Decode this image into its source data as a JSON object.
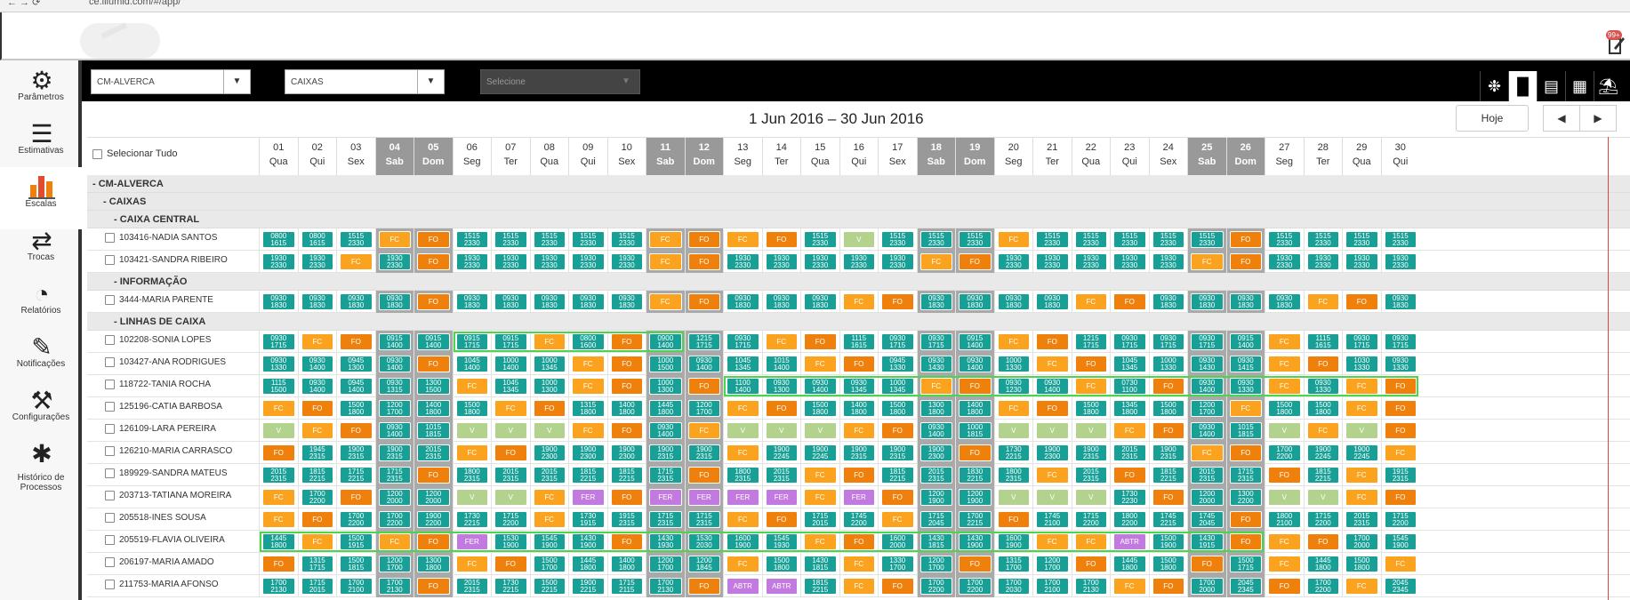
{
  "browser": {
    "url": "ce.illumid.com/#/app/"
  },
  "notifications": {
    "badge": "99+"
  },
  "sidebar": {
    "items": [
      {
        "label": "Parâmetros",
        "icon": "gear-icon"
      },
      {
        "label": "Estimativas",
        "icon": "chart-line-icon"
      },
      {
        "label": "Escalas",
        "icon": "bar-chart-icon"
      },
      {
        "label": "Trocas",
        "icon": "swap-icon"
      },
      {
        "label": "Relatórios",
        "icon": "pie-chart-icon"
      },
      {
        "label": "Notificações",
        "icon": "notification-edit-icon"
      },
      {
        "label": "Configurações",
        "icon": "settings-tools-icon"
      },
      {
        "label": "Histórico de Processos",
        "icon": "history-calendar-icon"
      }
    ]
  },
  "filters": {
    "store": "CM-ALVERCA",
    "department": "CAIXAS",
    "third_placeholder": "Selecione"
  },
  "views": [
    "settings-icon",
    "bar-chart-icon",
    "column-chart-icon",
    "calendar-icon",
    "vacation-icon"
  ],
  "calendar": {
    "title": "1 Jun 2016 – 30 Jun 2016",
    "today_label": "Hoje",
    "prev": "◀",
    "next": "▶"
  },
  "grid": {
    "select_all_label": "Selecionar Tudo"
  },
  "days": [
    {
      "n": "01",
      "w": "Qua"
    },
    {
      "n": "02",
      "w": "Qui"
    },
    {
      "n": "03",
      "w": "Sex"
    },
    {
      "n": "04",
      "w": "Sab",
      "we": true
    },
    {
      "n": "05",
      "w": "Dom",
      "we": true
    },
    {
      "n": "06",
      "w": "Seg"
    },
    {
      "n": "07",
      "w": "Ter"
    },
    {
      "n": "08",
      "w": "Qua"
    },
    {
      "n": "09",
      "w": "Qui"
    },
    {
      "n": "10",
      "w": "Sex"
    },
    {
      "n": "11",
      "w": "Sab",
      "we": true
    },
    {
      "n": "12",
      "w": "Dom",
      "we": true
    },
    {
      "n": "13",
      "w": "Seg"
    },
    {
      "n": "14",
      "w": "Ter"
    },
    {
      "n": "15",
      "w": "Qua"
    },
    {
      "n": "16",
      "w": "Qui"
    },
    {
      "n": "17",
      "w": "Sex"
    },
    {
      "n": "18",
      "w": "Sab",
      "we": true
    },
    {
      "n": "19",
      "w": "Dom",
      "we": true
    },
    {
      "n": "20",
      "w": "Seg"
    },
    {
      "n": "21",
      "w": "Ter"
    },
    {
      "n": "22",
      "w": "Qua"
    },
    {
      "n": "23",
      "w": "Qui"
    },
    {
      "n": "24",
      "w": "Sex"
    },
    {
      "n": "25",
      "w": "Sab",
      "we": true
    },
    {
      "n": "26",
      "w": "Dom",
      "we": true
    },
    {
      "n": "27",
      "w": "Seg"
    },
    {
      "n": "28",
      "w": "Ter"
    },
    {
      "n": "29",
      "w": "Qua"
    },
    {
      "n": "30",
      "w": "Qui"
    }
  ],
  "shift_types": {
    "t": {
      "color": "#18a096"
    },
    "FO": {
      "color": "#f0800c"
    },
    "FC": {
      "color": "#fba31f"
    },
    "V": {
      "color": "#b3d28e"
    },
    "FER": {
      "color": "#c27ae0"
    },
    "ABTR": {
      "color": "#c27ae0"
    }
  },
  "rows": [
    {
      "type": "group",
      "level": 0,
      "label": "- CM-ALVERCA"
    },
    {
      "type": "group",
      "level": 1,
      "label": "- CAIXAS"
    },
    {
      "type": "group",
      "level": 2,
      "label": "- CAIXA CENTRAL"
    },
    {
      "type": "emp",
      "name": "103416-NADIA SANTOS",
      "cells": [
        "0800 1615",
        "0800 1615",
        "1515 2330",
        "FC",
        "FO",
        "1515 2330",
        "1515 2330",
        "1515 2330",
        "1515 2330",
        "1515 2330",
        "FC",
        "FO",
        "FC",
        "FO",
        "1515 2330",
        "V",
        "1515 2330",
        "1515 2330",
        "1515 2330",
        "FC",
        "1515 2330",
        "1515 2330",
        "1515 2330",
        "1515 2330",
        "1515 2330",
        "FO",
        "1515 2330",
        "1515 2330",
        "1515 2330",
        "1515 2330"
      ]
    },
    {
      "type": "emp",
      "name": "103421-SANDRA RIBEIRO",
      "cells": [
        "1930 2330",
        "1930 2330",
        "FC",
        "1930 2330",
        "FO",
        "1930 2330",
        "1930 2330",
        "1930 2330",
        "1930 2330",
        "1930 2330",
        "FC",
        "FO",
        "1930 2330",
        "1930 2330",
        "1930 2330",
        "1930 2330",
        "1930 2330",
        "FC",
        "FO",
        "1930 2330",
        "1930 2330",
        "1930 2330",
        "1930 2330",
        "1930 2330",
        "FC",
        "FO",
        "1930 2330",
        "1930 2330",
        "1930 2330",
        "1930 2330"
      ]
    },
    {
      "type": "group",
      "level": 2,
      "label": "- INFORMAÇÃO"
    },
    {
      "type": "emp",
      "name": "3444-MARIA PARENTE",
      "cells": [
        "0930 1830",
        "0930 1830",
        "0930 1830",
        "0930 1830",
        "FO",
        "0930 1830",
        "0930 1830",
        "0930 1830",
        "0930 1830",
        "0930 1830",
        "FC",
        "FO",
        "0930 1830",
        "0930 1830",
        "0930 1830",
        "FC",
        "FO",
        "0930 1830",
        "0930 1830",
        "0930 1830",
        "0930 1830",
        "FC",
        "FO",
        "0930 1830",
        "0930 1830",
        "0930 1830",
        "0930 1830",
        "FC",
        "FO",
        "0930 1830"
      ]
    },
    {
      "type": "group",
      "level": 2,
      "label": "- LINHAS DE CAIXA"
    },
    {
      "type": "emp",
      "name": "102208-SONIA LOPES",
      "hl": [
        [
          6,
          11
        ]
      ],
      "cells": [
        "0930 1715",
        "FC",
        "FO",
        "0915 1400",
        "0915 1400",
        "0915 1715",
        "0915 1715",
        "FC",
        "0800 1600",
        "FO",
        "0900 1400",
        "1215 1715",
        "0930 1715",
        "FC",
        "FO",
        "1115 1615",
        "0930 1715",
        "0930 1715",
        "0915 1400",
        "FC",
        "FO",
        "1215 1715",
        "0930 1715",
        "0930 1715",
        "0930 1715",
        "0915 1400",
        "FC",
        "1115 1615",
        "0930 1715",
        "0930 1715"
      ]
    },
    {
      "type": "emp",
      "name": "103427-ANA RODRIGUES",
      "cells": [
        "0930 1330",
        "0930 1400",
        "0945 1300",
        "0930 1400",
        "FO",
        "1045 1400",
        "1000 1400",
        "1000 1345",
        "FC",
        "FO",
        "1000 1500",
        "0930 1400",
        "1045 1345",
        "1015 1400",
        "FC",
        "FO",
        "0945 1330",
        "0930 1430",
        "0930 1400",
        "1000 1330",
        "FC",
        "FO",
        "1045 1345",
        "1000 1330",
        "0930 1430",
        "0930 1415",
        "FC",
        "FO",
        "1030 1330",
        "0930 1330"
      ]
    },
    {
      "type": "emp",
      "name": "118722-TANIA ROCHA",
      "hl": [
        [
          13,
          30
        ]
      ],
      "cells": [
        "1115 1500",
        "0930 1400",
        "0945 1400",
        "0930 1315",
        "1300 1500",
        "FC",
        "1045 1345",
        "1000 1300",
        "FC",
        "FO",
        "1000 1300",
        "FO",
        "1100 1400",
        "0930 1300",
        "0930 1400",
        "0930 1345",
        "1000 1345",
        "FC",
        "FO",
        "0930 1230",
        "0930 1400",
        "FC",
        "0730 1100",
        "FO",
        "0930 1400",
        "0930 1330",
        "FC",
        "0930 1330",
        "FC",
        "FO"
      ]
    },
    {
      "type": "emp",
      "name": "125196-CATIA BARBOSA",
      "cells": [
        "FC",
        "FO",
        "1500 1800",
        "1200 1700",
        "1400 1800",
        "1500 1800",
        "FC",
        "FO",
        "1315 1800",
        "1400 1800",
        "1445 1800",
        "1200 1700",
        "FC",
        "FO",
        "1500 1800",
        "1400 1800",
        "1500 1800",
        "1300 1800",
        "1400 1800",
        "FC",
        "FO",
        "1500 1800",
        "1345 1800",
        "1500 1800",
        "1200 1700",
        "FC",
        "1500 1800",
        "1500 1800",
        "FC",
        "FO"
      ]
    },
    {
      "type": "emp",
      "name": "126109-LARA PEREIRA",
      "cells": [
        "V",
        "FC",
        "FO",
        "0930 1400",
        "1015 1815",
        "V",
        "V",
        "V",
        "FC",
        "FO",
        "0930 1400",
        "FC",
        "V",
        "V",
        "V",
        "FC",
        "FO",
        "0930 1400",
        "1000 1815",
        "V",
        "V",
        "V",
        "FC",
        "FO",
        "0930 1400",
        "1015 1815",
        "V",
        "FC",
        "V",
        "FO"
      ]
    },
    {
      "type": "emp",
      "name": "126210-MARIA CARRASCO",
      "cells": [
        "FO",
        "1945 2315",
        "1900 2315",
        "1900 2315",
        "2015 2315",
        "FC",
        "FO",
        "1900 2300",
        "1900 2300",
        "1900 2300",
        "1900 2315",
        "1900 2315",
        "FC",
        "1900 2245",
        "1900 2245",
        "1900 2315",
        "1900 2315",
        "1900 2300",
        "FO",
        "1730 2215",
        "1900 2300",
        "1900 2315",
        "2015 2315",
        "1900 2315",
        "FC",
        "FO",
        "1700 2200",
        "1900 2245",
        "1900 2245",
        "FC"
      ]
    },
    {
      "type": "emp",
      "name": "189929-SANDRA MATEUS",
      "cells": [
        "2015 2315",
        "1815 2215",
        "1715 2215",
        "1715 2315",
        "FO",
        "1800 2315",
        "2015 2315",
        "2015 2315",
        "1815 2215",
        "1815 2215",
        "1715 2315",
        "FO",
        "1800 2315",
        "2015 2315",
        "FC",
        "FO",
        "1815 2215",
        "2015 2315",
        "1830 2215",
        "1800 2315",
        "FC",
        "2015 2315",
        "FO",
        "1815 2215",
        "2015 2315",
        "1715 2315",
        "FO",
        "1815 2215",
        "FC",
        "1915 2315"
      ]
    },
    {
      "type": "emp",
      "name": "203713-TATIANA MOREIRA",
      "cells": [
        "FC",
        "1700 2200",
        "FO",
        "1200 2000",
        "1200 2000",
        "V",
        "V",
        "FC",
        "FER",
        "FO",
        "FER",
        "FER",
        "FER",
        "FER",
        "FC",
        "FER",
        "FO",
        "1200 1900",
        "1200 1900",
        "V",
        "V",
        "V",
        "1730 2230",
        "FO",
        "1200 2000",
        "1300 2200",
        "V",
        "V",
        "FC",
        "FO"
      ]
    },
    {
      "type": "emp",
      "name": "205518-INES SOUSA",
      "cells": [
        "FC",
        "FO",
        "1700 2200",
        "1700 2200",
        "1900 2200",
        "1730 2215",
        "1715 2200",
        "FC",
        "1730 1915",
        "1915 2315",
        "1715 2315",
        "1715 2315",
        "FC",
        "FO",
        "1715 2015",
        "1745 2200",
        "FC",
        "1715 2045",
        "1700 2215",
        "FO",
        "1745 2100",
        "1715 2200",
        "1800 2200",
        "1745 2215",
        "1745 2045",
        "FO",
        "1800 2100",
        "1715 2200",
        "2015 2315",
        "1715 2200"
      ]
    },
    {
      "type": "emp",
      "name": "205519-FLAVIA OLIVEIRA",
      "hl": [
        [
          1,
          26
        ]
      ],
      "cells": [
        "1445 1800",
        "FC",
        "1500 1915",
        "FC",
        "FO",
        "FER",
        "1530 1900",
        "1545 1900",
        "1430 1900",
        "FO",
        "1430 1930",
        "1530 2030",
        "1600 1900",
        "1545 1930",
        "FC",
        "FO",
        "1600 2000",
        "1430 1815",
        "1430 1900",
        "1600 1900",
        "FC",
        "FC",
        "ABTR",
        "1500 1900",
        "1430 1915",
        "FO",
        "FC",
        "FO",
        "1700 2000",
        "1545 1900"
      ]
    },
    {
      "type": "emp",
      "name": "206197-MARIA AMADO",
      "cells": [
        "FO",
        "1315 1715",
        "1500 1815",
        "1200 1700",
        "1300 1800",
        "FC",
        "FO",
        "1500 1700",
        "1445 1800",
        "1400 1800",
        "1200 1700",
        "1200 1845",
        "FC",
        "1500 1800",
        "1430 1815",
        "FC",
        "1330 1700",
        "1200 1700",
        "FO",
        "1315 1700",
        "1200 1700",
        "FO",
        "1445 1800",
        "1500 1800",
        "FO",
        "1500 1715",
        "FC",
        "1445 1800",
        "1500 1800",
        "FC"
      ]
    },
    {
      "type": "emp",
      "name": "211753-MARIA AFONSO",
      "cells": [
        "1700 2130",
        "1715 2015",
        "1700 2100",
        "1700 2130",
        "FO",
        "2015 2315",
        "1730 2215",
        "1500 2215",
        "1900 2215",
        "1715 2115",
        "1700 2130",
        "FO",
        "ABTR",
        "ABTR",
        "1815 2215",
        "FC",
        "FO",
        "1700 2200",
        "1700 2200",
        "1700 2030",
        "1700 2100",
        "1700 2130",
        "FC",
        "FO",
        "1700 2000",
        "2045 2345",
        "FO",
        "1700 2200",
        "FC",
        "2045 2345"
      ]
    }
  ]
}
